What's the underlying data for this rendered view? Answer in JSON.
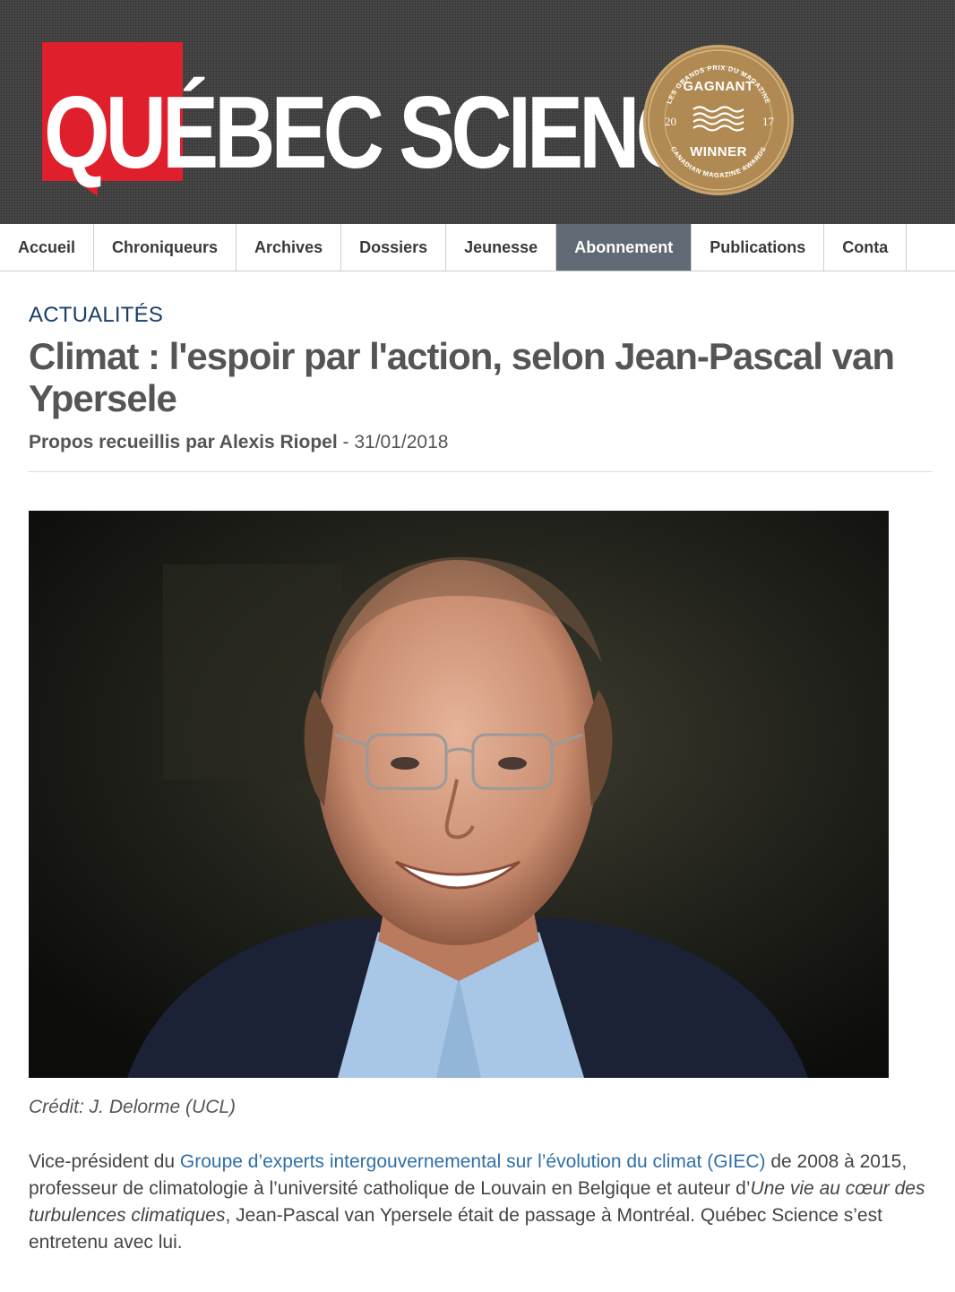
{
  "logo": {
    "wordmark": "QUÉBEC SCIENCE"
  },
  "badge": {
    "arc_top": "LES GRANDS PRIX DU MAGAZINE",
    "gagnant": "GAGNANT",
    "year_left": "20",
    "year_right": "17",
    "winner": "WINNER",
    "arc_bottom": "CANADIAN MAGAZINE AWARDS"
  },
  "nav": {
    "items": [
      "Accueil",
      "Chroniqueurs",
      "Archives",
      "Dossiers",
      "Jeunesse",
      "Abonnement",
      "Publications",
      "Conta"
    ],
    "active": "Abonnement"
  },
  "article": {
    "category": "ACTUALITÉS",
    "title": "Climat : l'espoir par l'action, selon Jean-Pascal van Ypersele",
    "byline_author": "Propos recueillis par Alexis Riopel",
    "byline_separator": " - ",
    "byline_date": "31/01/2018",
    "photo_credit": "Crédit: J. Delorme (UCL)",
    "lead": {
      "part1": "Vice-président du ",
      "link": "Groupe d’experts intergouvernemental sur l’évolution du climat (GIEC)",
      "part2": " de 2008 à 2015, professeur de climatologie à l’université catholique de Louvain en Belgique et auteur d’",
      "book": "Une vie au cœur des turbulences climatiques",
      "part3": ", Jean-Pascal van Ypersele était de passage à Montréal. Québec Science s’est entretenu avec lui."
    }
  },
  "colors": {
    "header_bg": "#4d4d4d",
    "logo_red": "#e01f2d",
    "badge_gold": "#b08a52",
    "nav_active_bg": "#5f6a75",
    "category_blue": "#1a3e66",
    "link_blue": "#2f6fa8"
  }
}
